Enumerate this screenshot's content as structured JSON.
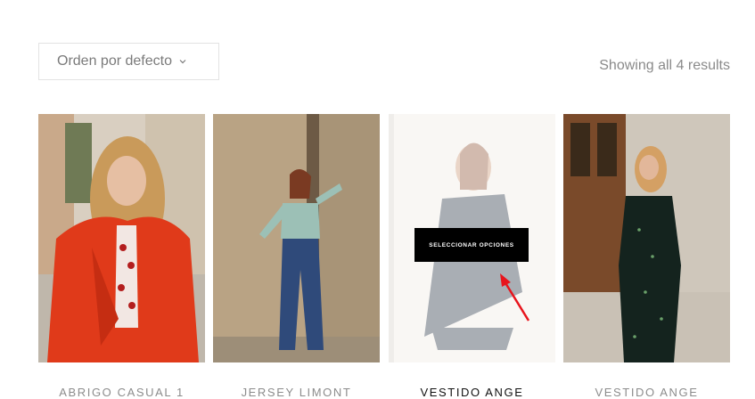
{
  "sort": {
    "selected": "Orden por defecto",
    "icon": "chevron-down-icon"
  },
  "results": {
    "text": "Showing all 4 results"
  },
  "products": [
    {
      "title": "ABRIGO CASUAL 1"
    },
    {
      "title": "JERSEY LIMONT"
    },
    {
      "title": "VESTIDO ANGE",
      "hover_button": "SELECCIONAR OPCIONES"
    },
    {
      "title": "VESTIDO ANGE"
    }
  ],
  "colors": {
    "accent_button": "#000000",
    "annotation_arrow": "#e8141c"
  }
}
